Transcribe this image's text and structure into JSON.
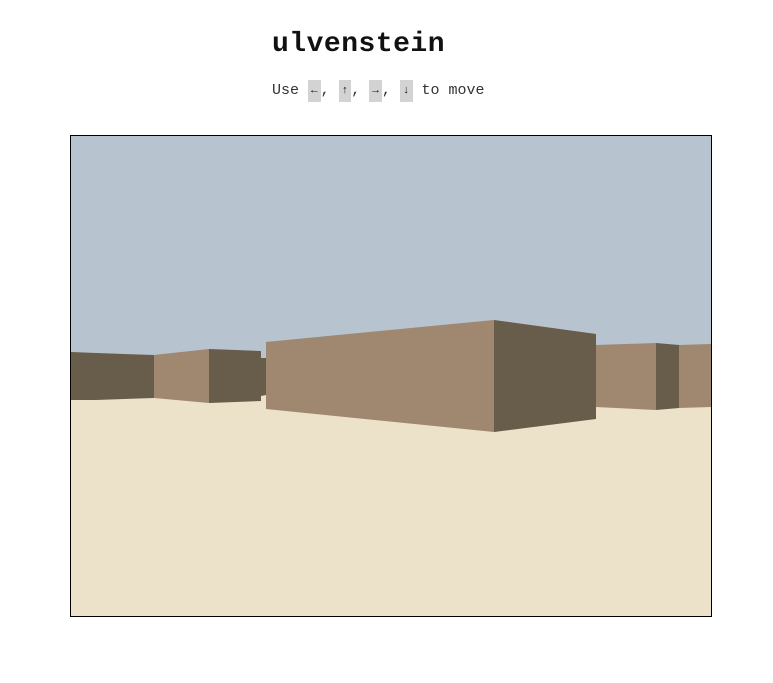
{
  "title": "ulvenstein",
  "instructions": {
    "prefix": "Use ",
    "keys": [
      "←",
      "↑",
      "→",
      "↓"
    ],
    "separator": ", ",
    "suffix": " to move"
  },
  "scene": {
    "sky_color": "#b7c3cf",
    "floor_color": "#ece2ca",
    "wall_light_color": "#a08770",
    "wall_dark_color": "#685c4a"
  }
}
